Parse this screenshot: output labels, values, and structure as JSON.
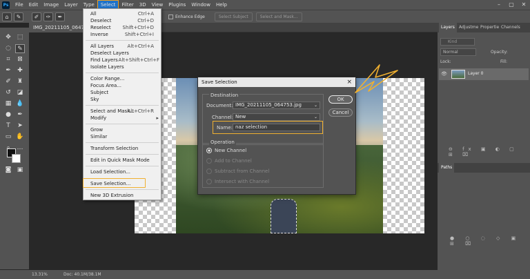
{
  "menubar": {
    "logo": "Ps",
    "items": [
      "File",
      "Edit",
      "Image",
      "Layer",
      "Type",
      "Select",
      "Filter",
      "3D",
      "View",
      "Plugins",
      "Window",
      "Help"
    ],
    "active": "Select"
  },
  "optionsbar": {
    "antialias": "Anti-alias",
    "enhance_edge": "Enhance Edge",
    "select_subject": "Select Subject",
    "select_and_mask": "Select and Mask..."
  },
  "document": {
    "tab_title": "IMG_20211105_064753...",
    "zoom": "13.31%",
    "doc_size": "Doc: 40.1M/38.1M"
  },
  "select_menu": [
    {
      "label": "All",
      "shortcut": "Ctrl+A"
    },
    {
      "label": "Deselect",
      "shortcut": "Ctrl+D"
    },
    {
      "label": "Reselect",
      "shortcut": "Shift+Ctrl+D"
    },
    {
      "label": "Inverse",
      "shortcut": "Shift+Ctrl+I"
    },
    {
      "label": "All Layers",
      "shortcut": "Alt+Ctrl+A"
    },
    {
      "label": "Deselect Layers",
      "shortcut": ""
    },
    {
      "label": "Find Layers",
      "shortcut": "Alt+Shift+Ctrl+F"
    },
    {
      "label": "Isolate Layers",
      "shortcut": ""
    },
    {
      "label": "Color Range...",
      "shortcut": ""
    },
    {
      "label": "Focus Area...",
      "shortcut": ""
    },
    {
      "label": "Subject",
      "shortcut": ""
    },
    {
      "label": "Sky",
      "shortcut": ""
    },
    {
      "label": "Select and Mask...",
      "shortcut": "Alt+Ctrl+R"
    },
    {
      "label": "Modify",
      "shortcut": "▸"
    },
    {
      "label": "Grow",
      "shortcut": ""
    },
    {
      "label": "Similar",
      "shortcut": ""
    },
    {
      "label": "Transform Selection",
      "shortcut": ""
    },
    {
      "label": "Edit in Quick Mask Mode",
      "shortcut": ""
    },
    {
      "label": "Load Selection...",
      "shortcut": ""
    },
    {
      "label": "Save Selection...",
      "shortcut": ""
    },
    {
      "label": "New 3D Extrusion",
      "shortcut": ""
    }
  ],
  "dialog": {
    "title": "Save Selection",
    "close": "×",
    "destination_label": "Destination",
    "document_label": "Document:",
    "document_value": "IMG_20211105_064753.jpg",
    "channel_label": "Channel:",
    "channel_value": "New",
    "name_label": "Name:",
    "name_value": "naz selection",
    "operation_label": "Operation",
    "operations": [
      "New Channel",
      "Add to Channel",
      "Subtract from Channel",
      "Intersect with Channel"
    ],
    "ok": "OK",
    "cancel": "Cancel"
  },
  "layers_panel": {
    "tabs": [
      "Layers",
      "Adjustme",
      "Propertie",
      "Channels"
    ],
    "search_placeholder": "Kind",
    "blend_mode": "Normal",
    "opacity_label": "Opacity:",
    "lock_label": "Lock:",
    "fill_label": "Fill:",
    "layer_name": "Layer 0"
  },
  "paths_panel": {
    "tab": "Paths"
  },
  "colors": {
    "highlight": "#f0b030",
    "menubar": "#535353",
    "dialog": "#535353"
  }
}
